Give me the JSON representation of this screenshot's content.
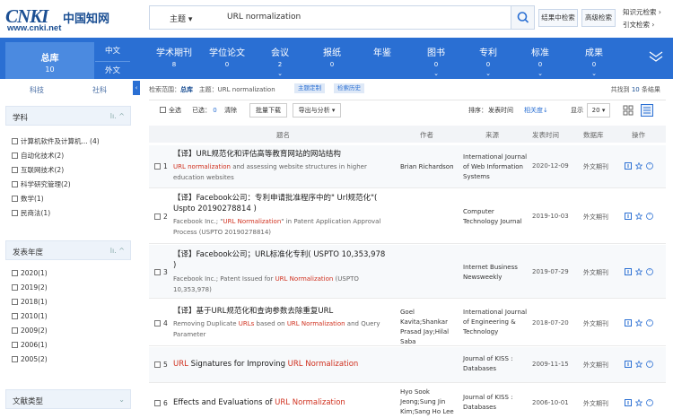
{
  "header": {
    "logo_main": "CNKI",
    "logo_cn": "中国知网",
    "logo_url": "www.cnki.net",
    "search_type": "主题",
    "search_value": "URL normalization",
    "btn_in_results": "结果中检索",
    "btn_advanced": "高级检索",
    "link_knowledge": "知识元检索",
    "link_citation": "引文检索"
  },
  "nav": {
    "zongku_label": "总库",
    "zongku_count": "10",
    "zh_label": "中文",
    "en_label": "外文",
    "tabs": [
      {
        "label": "学术期刊",
        "count": "8"
      },
      {
        "label": "学位论文",
        "count": "0"
      },
      {
        "label": "会议",
        "count": "2"
      },
      {
        "label": "报纸",
        "count": "0"
      },
      {
        "label": "年鉴",
        "count": ""
      },
      {
        "label": "图书",
        "count": "0"
      },
      {
        "label": "专利",
        "count": "0"
      },
      {
        "label": "标准",
        "count": "0"
      },
      {
        "label": "成果",
        "count": "0"
      }
    ]
  },
  "sidebar": {
    "tab_tech": "科技",
    "tab_social": "社科",
    "subject_title": "学科",
    "subjects": [
      "计算机软件及计算机... (4)",
      "自动化技术(2)",
      "互联网技术(2)",
      "科学研究管理(2)",
      "数学(1)",
      "民商法(1)"
    ],
    "year_title": "发表年度",
    "years": [
      "2020(1)",
      "2019(2)",
      "2018(1)",
      "2010(1)",
      "2009(2)",
      "2006(1)",
      "2005(2)"
    ],
    "doctype_title": "文献类型"
  },
  "crumbs": {
    "scope_label": "检索范围：",
    "scope_value": "总库",
    "topic": "主题：URL normalization",
    "chip_custom": "主题定制",
    "chip_history": "检索历史",
    "found_prefix": "共找到",
    "found_count": "10",
    "found_suffix": "条结果"
  },
  "toolbar": {
    "select_all": "全选",
    "selected_label": "已选：",
    "selected_count": "0",
    "clear": "清除",
    "batch_download": "批量下载",
    "export": "导出与分析",
    "sort_label": "排序：",
    "sort_date": "发表时间",
    "sort_relevance": "相关度",
    "show_label": "显示",
    "per_page": "20"
  },
  "table": {
    "headers": {
      "title": "题名",
      "author": "作者",
      "source": "来源",
      "date": "发表时间",
      "db": "数据库",
      "ops": "操作"
    },
    "rows": [
      {
        "num": "1",
        "title": "【译】URL规范化和评估高等教育网站的网站结构",
        "sub_a": "URL normalization",
        "sub_b": " and assessing website structures in higher education websites",
        "author": "Brian Richardson",
        "source": "International Journal of Web Information Systems",
        "date": "2020-12-09",
        "db": "外文期刊"
      },
      {
        "num": "2",
        "title": "【译】Facebook公司：专利申请批准程序中的\" Url规范化\"( Uspto 20190278814 )",
        "sub_a": "Facebook Inc.; \"",
        "sub_hl": "URL Normalization",
        "sub_b": "\" in Patent Application Approval Process (USPTO 20190278814)",
        "author": "",
        "source": "Computer Technology Journal",
        "date": "2019-10-03",
        "db": "外文期刊"
      },
      {
        "num": "3",
        "title": "【译】Facebook公司；URL标准化专利( USPTO 10,353,978 )",
        "sub_a": "Facebook Inc.; Patent Issued for ",
        "sub_hl": "URL Normalization",
        "sub_b": " (USPTO 10,353,978)",
        "author": "",
        "source": "Internet Business Newsweekly",
        "date": "2019-07-29",
        "db": "外文期刊"
      },
      {
        "num": "4",
        "title": "【译】基于URL规范化和查询参数去除重复URL",
        "sub_a": "Removing Duplicate ",
        "sub_hl1": "URLs",
        "sub_mid": " based on ",
        "sub_hl2": "URL Normalization",
        "sub_b": " and Query Parameter",
        "author": "Goel Kavita;Shankar Prasad Jay;Hilal Saba",
        "source": "International Journal of Engineering & Technology",
        "date": "2018-07-20",
        "db": "外文期刊"
      },
      {
        "num": "5",
        "title_hl1": "URL",
        "title_mid": " Signatures for Improving ",
        "title_hl2": "URL Normalization",
        "author": "",
        "source": "Journal of KISS : Databases",
        "date": "2009-11-15",
        "db": "外文期刊"
      },
      {
        "num": "6",
        "title_a": "Effects and Evaluations of ",
        "title_hl": "URL Normalization",
        "author": "Hyo Sook Jeong;Sung Jin Kim;Sang Ho Lee",
        "source": "Journal of KISS : Databases",
        "date": "2006-10-01",
        "db": "外文期刊"
      }
    ]
  },
  "colors": {
    "brand": "#2a6fd3",
    "highlight": "#d0311f",
    "logo": "#1b4f93"
  }
}
